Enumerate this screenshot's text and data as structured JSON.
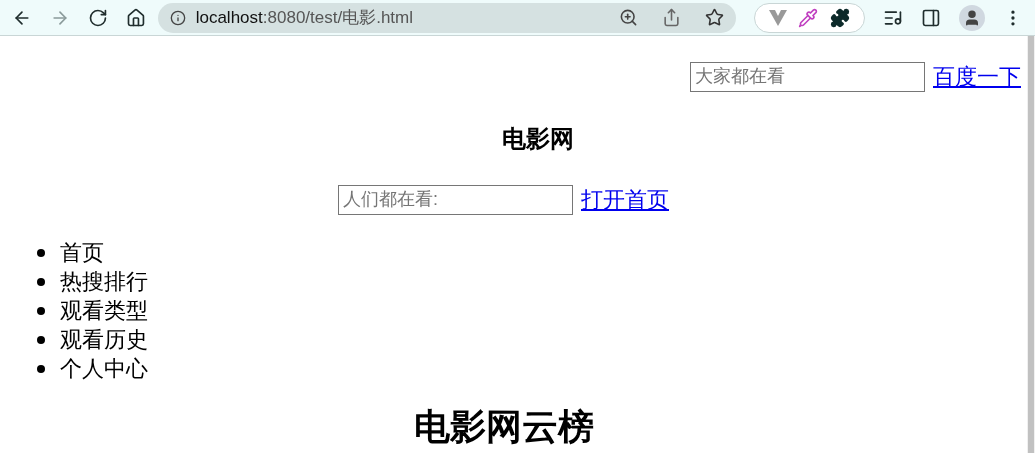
{
  "browser": {
    "url_host": "localhost",
    "url_rest": ":8080/test/电影.html"
  },
  "top_search": {
    "placeholder": "大家都在看",
    "link": "百度一下"
  },
  "site_title": "电影网",
  "home_search": {
    "placeholder": "人们都在看:",
    "link": "打开首页"
  },
  "nav_items": [
    "首页",
    "热搜排行",
    "观看类型",
    "观看历史",
    "个人中心"
  ],
  "section_heading": "电影网云榜"
}
